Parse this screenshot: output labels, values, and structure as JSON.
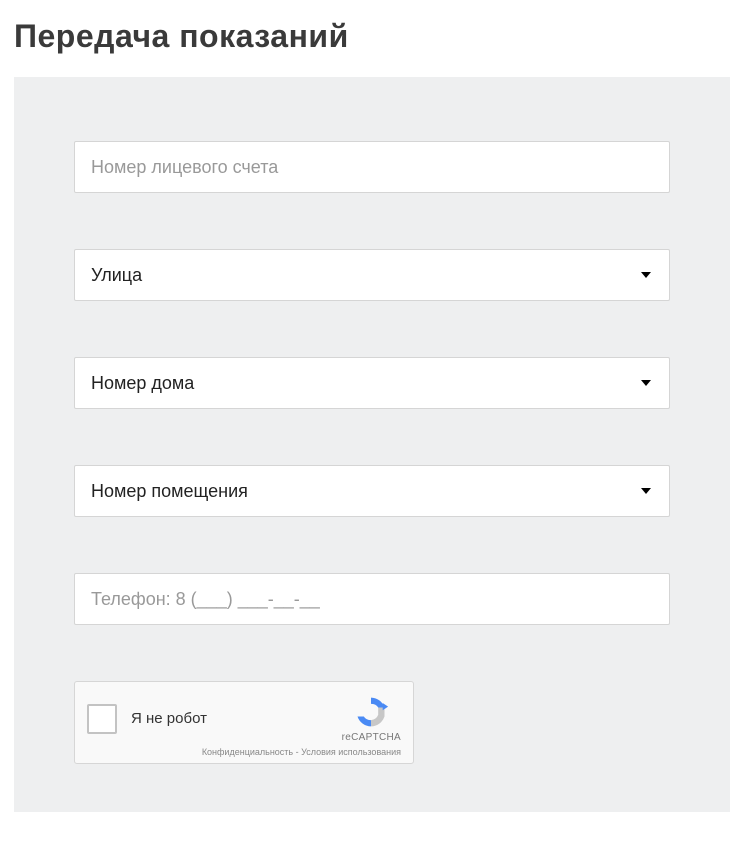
{
  "page": {
    "title": "Передача показаний"
  },
  "form": {
    "account_number": {
      "placeholder": "Номер лицевого счета",
      "value": ""
    },
    "street": {
      "selected": "Улица"
    },
    "house_number": {
      "selected": "Номер дома"
    },
    "apartment_number": {
      "selected": "Номер помещения"
    },
    "phone": {
      "placeholder": "Телефон: 8 (___) ___-__-__",
      "value": ""
    }
  },
  "recaptcha": {
    "label": "Я не робот",
    "brand": "reCAPTCHA",
    "links": "Конфиденциальность - Условия использования"
  }
}
